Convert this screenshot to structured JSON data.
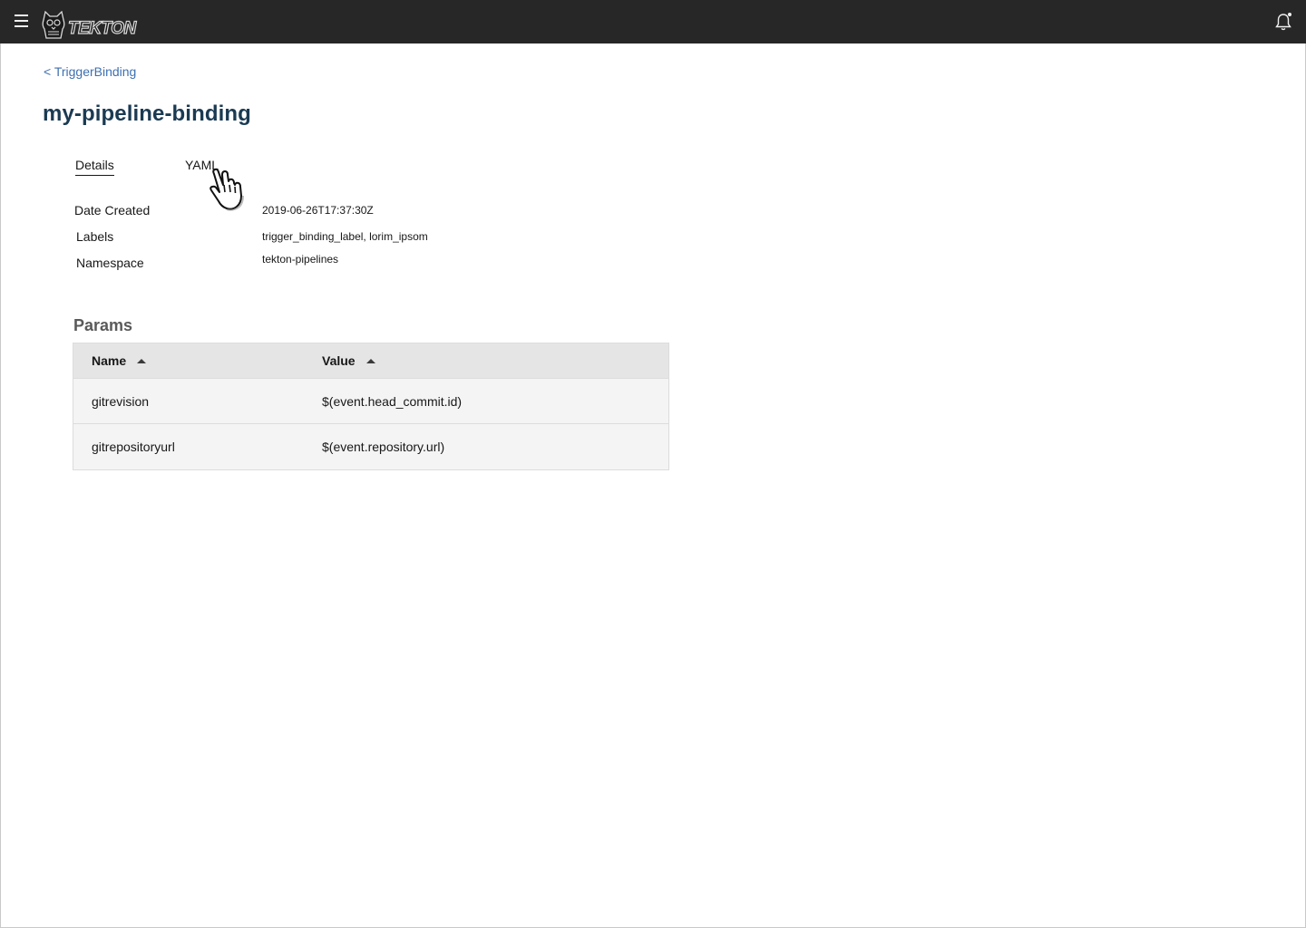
{
  "header": {
    "logo_text": "TEKTON",
    "menu_icon": "hamburger-menu-icon",
    "notification_icon": "bell-icon"
  },
  "breadcrumb": {
    "back_label": "< TriggerBinding"
  },
  "page": {
    "title": "my-pipeline-binding"
  },
  "tabs": [
    {
      "label": "Details",
      "active": true
    },
    {
      "label": "YAML",
      "active": false
    }
  ],
  "details": {
    "date_created_label": "Date Created",
    "date_created_value": "2019-06-26T17:37:30Z",
    "labels_label": "Labels",
    "labels_value": "trigger_binding_label, lorim_ipsom",
    "namespace_label": "Namespace",
    "namespace_value": "tekton-pipelines"
  },
  "params": {
    "title": "Params",
    "columns": [
      "Name",
      "Value"
    ],
    "rows": [
      {
        "name": "gitrevision",
        "value": "$(event.head_commit.id)"
      },
      {
        "name": "gitrepositoryurl",
        "value": "$(event.repository.url)"
      }
    ]
  },
  "colors": {
    "header_bg": "#272727",
    "link": "#3d70b2",
    "title": "#1a3a52",
    "table_header_bg": "#e5e5e5",
    "table_row_bg": "#f4f4f4"
  }
}
